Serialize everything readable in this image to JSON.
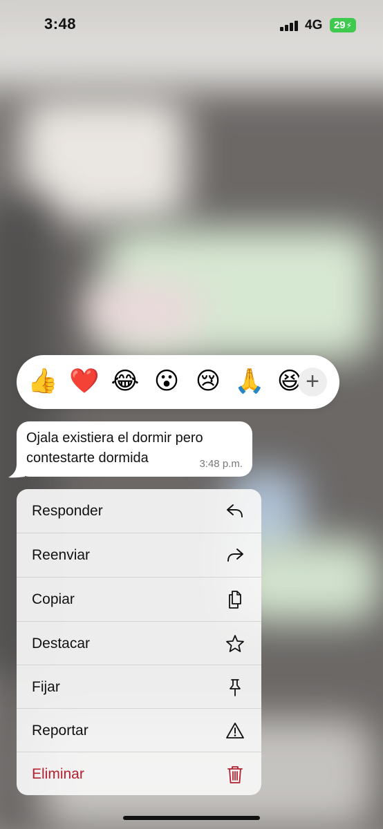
{
  "status_bar": {
    "time": "3:48",
    "network": "4G",
    "battery": "29"
  },
  "reactions": {
    "emojis": [
      "👍",
      "❤️",
      "😂",
      "😮",
      "😢",
      "🙏",
      "😆"
    ],
    "more_label": "+"
  },
  "message": {
    "text": "Ojala existiera el dormir pero\ncontestarte dormida",
    "time": "3:48 p.m."
  },
  "menu": {
    "items": [
      {
        "label": "Responder",
        "icon": "reply-icon"
      },
      {
        "label": "Reenviar",
        "icon": "forward-icon"
      },
      {
        "label": "Copiar",
        "icon": "copy-icon"
      },
      {
        "label": "Destacar",
        "icon": "star-icon"
      },
      {
        "label": "Fijar",
        "icon": "pin-icon"
      },
      {
        "label": "Reportar",
        "icon": "warning-icon"
      },
      {
        "label": "Eliminar",
        "icon": "trash-icon"
      }
    ]
  },
  "colors": {
    "danger": "#b3202f",
    "battery": "#3fc94f"
  }
}
